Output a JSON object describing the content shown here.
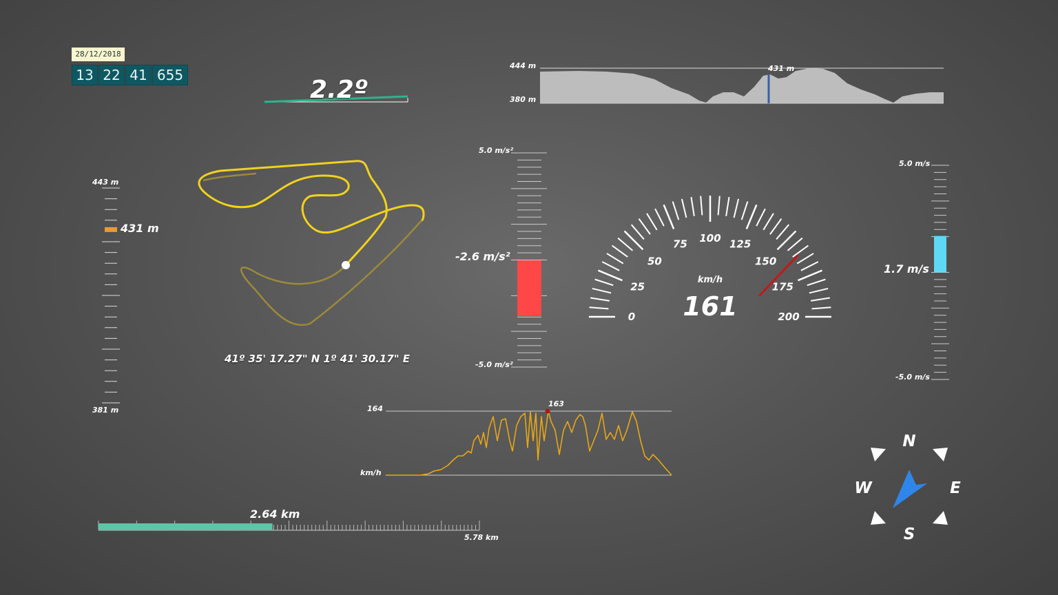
{
  "datetime": {
    "date": "28/12/2018",
    "hours": "13",
    "minutes": "22",
    "seconds": "41",
    "milliseconds": "655"
  },
  "incline": {
    "value": "2.2º"
  },
  "elevation_profile": {
    "max_label": "444 m",
    "min_label": "380 m",
    "current_label": "431 m",
    "current_position": 0.56,
    "fill_color": "#bdbdbd",
    "marker_color": "#3b5fa8"
  },
  "altitude_gauge": {
    "max_label": "443 m",
    "min_label": "381 m",
    "value_label": "431 m",
    "value": 431,
    "min": 381,
    "max": 443,
    "marker_color": "#e89a3c"
  },
  "track_map": {
    "coordinates": "41º 35' 17.27\" N 1º 41' 30.17\" E",
    "track_color": "#f1d21c",
    "faded_color": "#9b8a3a"
  },
  "longitudinal_accel": {
    "max_label": "5.0 m/s²",
    "min_label": "-5.0 m/s²",
    "value_label": "-2.6 m/s²",
    "value": -2.6,
    "min": -5.0,
    "max": 5.0,
    "bar_color": "#ff4747"
  },
  "speedometer": {
    "unit": "km/h",
    "value_label": "161",
    "value": 161,
    "min": 0,
    "max": 200,
    "ticks": [
      "0",
      "25",
      "50",
      "75",
      "100",
      "125",
      "150",
      "175",
      "200"
    ],
    "needle_color": "#c0191a"
  },
  "vertical_speed": {
    "max_label": "5.0 m/s",
    "min_label": "-5.0 m/s",
    "value_label": "1.7 m/s",
    "value": 1.7,
    "min": -5.0,
    "max": 5.0,
    "bar_color": "#5fd8f5"
  },
  "speed_history": {
    "max_label": "164",
    "unit_label": "km/h",
    "peak_label": "163",
    "line_color": "#e8a717",
    "marker_color": "#b01717"
  },
  "distance": {
    "current_label": "2.64 km",
    "total_label": "5.78 km",
    "current": 2.64,
    "total": 5.78,
    "bar_color": "#5fc4a8"
  },
  "compass": {
    "north": "N",
    "south": "S",
    "east": "E",
    "west": "W",
    "heading_deg": 220,
    "needle_color": "#2f86ea"
  }
}
